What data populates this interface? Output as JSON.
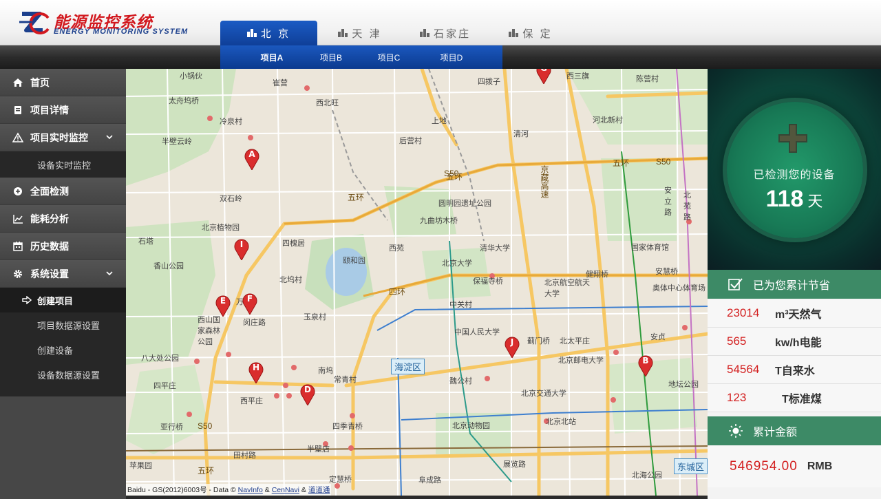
{
  "app": {
    "logo_title": "能源监控系统",
    "logo_subtitle": "ENERGY MONITORING SYSTEM"
  },
  "cities": [
    {
      "label": "北 京",
      "active": true
    },
    {
      "label": "天 津",
      "active": false
    },
    {
      "label": "石家庄",
      "active": false
    },
    {
      "label": "保 定",
      "active": false
    }
  ],
  "projects": [
    {
      "label": "项目A",
      "active": true
    },
    {
      "label": "项目B",
      "active": false
    },
    {
      "label": "项目C",
      "active": false
    },
    {
      "label": "项目D",
      "active": false
    }
  ],
  "sidebar": {
    "home": "首页",
    "project_detail": "项目详情",
    "realtime_monitor": "项目实时监控",
    "realtime_sub": "设备实时监控",
    "full_check": "全面检测",
    "energy_analysis": "能耗分析",
    "history": "历史数据",
    "system_settings": "系统设置",
    "settings_sub": [
      "创建项目",
      "项目数据源设置",
      "创建设备",
      "设备数据源设置"
    ]
  },
  "map": {
    "labels": [
      "小锅伙",
      "崔营",
      "西北旺",
      "太舟坞桥",
      "冷泉村",
      "半壁云岭",
      "上地",
      "后营村",
      "清河",
      "西三旗",
      "北京植物园",
      "双石岭",
      "四槐居",
      "圆明园遗址公园",
      "九曲坊木桥",
      "颐和园",
      "西苑",
      "清华大学",
      "北京大学",
      "石塔",
      "香山公园",
      "北坞村",
      "保福寺桥",
      "北京航空航天大学",
      "中关村",
      "万泉",
      "闵庄路",
      "玉泉村",
      "西山国家森林公园",
      "中国人民大学",
      "蓟门桥",
      "北太平庄",
      "北京邮电大学",
      "八大处公园",
      "南坞",
      "常青村",
      "魏公村",
      "北京交通大学",
      "四季青桥",
      "北京北站",
      "西平庄",
      "北京动物园",
      "四平庄",
      "亚行桥",
      "苹果园",
      "田村路",
      "半壁店",
      "展览路",
      "阜成路",
      "定慧桥",
      "北海公园",
      "国家体育馆",
      "安慧桥",
      "奥体中心体育场",
      "健翔桥",
      "安贞",
      "河北新村",
      "陈营村",
      "四拨子",
      "五环",
      "北苑路",
      "安立路",
      "地坛公园"
    ],
    "highways": [
      "S50",
      "S50",
      "S50",
      "五环",
      "五环",
      "五环",
      "四环",
      "京藏高速"
    ],
    "district_haidian": "海淀区",
    "district_dongcheng": "东城区",
    "pins": [
      "A",
      "B",
      "D",
      "E",
      "F",
      "G",
      "H",
      "I",
      "J"
    ],
    "copyright_prefix": "Baidu - GS(2012)6003号 - Data ©",
    "copyright_links": [
      "NavInfo",
      "CenNavi",
      "道道通"
    ],
    "copyright_amp": "&"
  },
  "panel": {
    "days_caption": "已检测您的设备",
    "days_value": "118",
    "days_unit": "天",
    "savings_title": "已为您累计节省",
    "savings": [
      {
        "value": "23014",
        "unit": "m³天然气"
      },
      {
        "value": "565",
        "unit": "kw/h电能"
      },
      {
        "value": "54564",
        "unit": "T自来水"
      },
      {
        "value": "123",
        "unit": "T标准煤"
      }
    ],
    "total_title": "累计金额",
    "total_value": "546954.00",
    "total_unit": "RMB"
  },
  "colors": {
    "brand_red": "#d2191f",
    "brand_blue": "#1b3f8c",
    "tab_blue": "#1b5bc4",
    "panel_green": "#3d8a66",
    "value_red": "#d32020"
  }
}
